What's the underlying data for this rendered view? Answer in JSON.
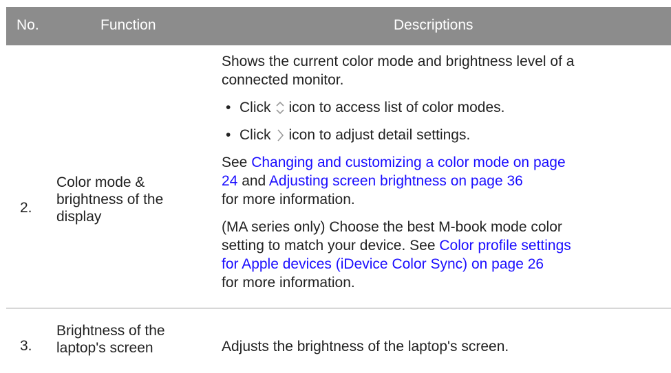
{
  "header": {
    "no": "No.",
    "function": "Function",
    "descriptions": "Descriptions"
  },
  "rows": [
    {
      "no": "2.",
      "function_lines": [
        "Color mode &",
        "brightness of the",
        "display"
      ],
      "desc": {
        "intro_lines": [
          "Shows the current color mode and brightness level of a",
          "connected monitor."
        ],
        "bullet1": {
          "before": "Click",
          "icon": "up-down-chevron-icon",
          "after": "icon to access list of color modes."
        },
        "bullet2": {
          "before": "Click",
          "icon": "chevron-right-icon",
          "after": "icon to adjust detail settings."
        },
        "see": {
          "lead": "See ",
          "link1_line1": "Changing and customizing a color mode on page",
          "link1_line2": "24",
          "mid": " and ",
          "link2": "Adjusting screen brightness on page 36",
          "tail": "for more information."
        },
        "ma": {
          "line1": "(MA series only) Choose the best M-book mode color",
          "line2_text": "setting to match your device. See ",
          "link_line1": "Color profile settings",
          "link_line2": "for Apple devices (iDevice Color Sync) on page 26",
          "tail": "for more information."
        }
      }
    },
    {
      "no": "3.",
      "function_lines": [
        "Brightness of the",
        "laptop's screen"
      ],
      "desc": "Adjusts the brightness of the laptop's screen."
    }
  ],
  "colors": {
    "header_bg": "#8c8c8c",
    "link": "#1a0dff",
    "text": "#222222"
  }
}
